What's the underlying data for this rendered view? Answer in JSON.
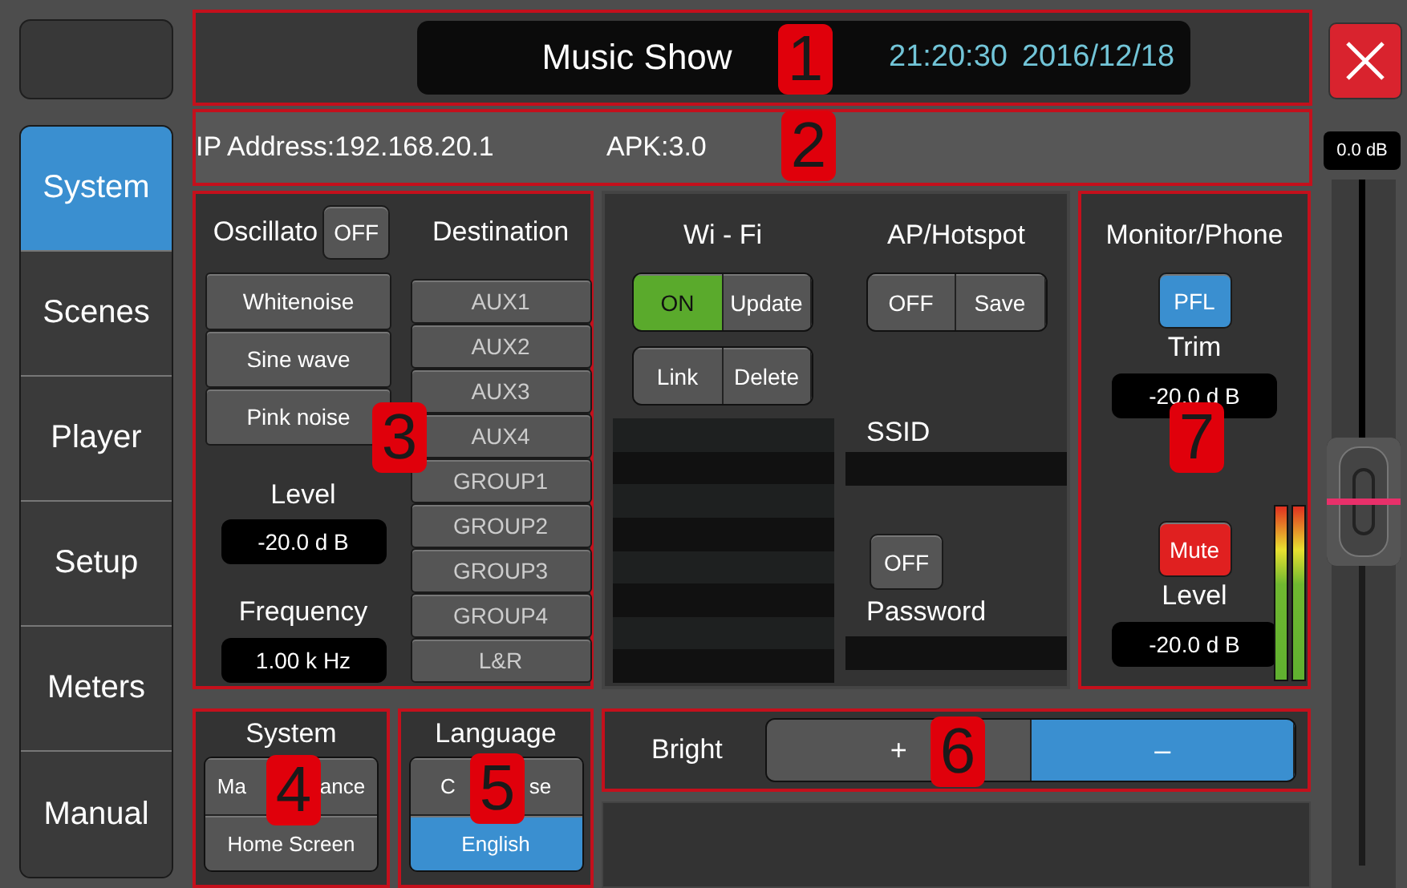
{
  "header": {
    "title": "Music Show",
    "time": "21:20:30",
    "date": "2016/12/18"
  },
  "nav": [
    {
      "label": "System",
      "selected": true
    },
    {
      "label": "Scenes",
      "selected": false
    },
    {
      "label": "Player",
      "selected": false
    },
    {
      "label": "Setup",
      "selected": false
    },
    {
      "label": "Meters",
      "selected": false
    },
    {
      "label": "Manual",
      "selected": false
    }
  ],
  "info": {
    "ip": "IP  Address:192.168.20.1",
    "apk": "APK:3.0"
  },
  "oscillator": {
    "label": "Oscillato",
    "power": {
      "label": "OFF",
      "on": false
    },
    "signals": [
      {
        "label": "Whitenoise",
        "selected": false
      },
      {
        "label": "Sine wave",
        "selected": false
      },
      {
        "label": "Pink noise",
        "selected": false
      }
    ],
    "level_label": "Level",
    "level_value": "-20.0 d B",
    "frequency_label": "Frequency",
    "frequency_value": "1.00 k Hz"
  },
  "destination": {
    "title": "Destination",
    "items": [
      {
        "label": "AUX1",
        "selected": false
      },
      {
        "label": "AUX2",
        "selected": false
      },
      {
        "label": "AUX3",
        "selected": false
      },
      {
        "label": "AUX4",
        "selected": false
      },
      {
        "label": "GROUP1",
        "selected": false
      },
      {
        "label": "GROUP2",
        "selected": false
      },
      {
        "label": "GROUP3",
        "selected": false
      },
      {
        "label": "GROUP4",
        "selected": false
      },
      {
        "label": "L&R",
        "selected": false
      }
    ]
  },
  "wifi": {
    "title": "Wi - Fi",
    "power": {
      "label": "ON",
      "on": true
    },
    "update": "Update",
    "link": "Link",
    "delete": "Delete"
  },
  "hotspot": {
    "title": "AP/Hotspot",
    "power": {
      "label": "OFF",
      "on": false
    },
    "save": "Save",
    "ssid_label": "SSID",
    "password_toggle": {
      "label": "OFF",
      "on": false
    },
    "password_label": "Password"
  },
  "monitor": {
    "title": "Monitor/Phone",
    "pfl": {
      "label": "PFL",
      "on": true
    },
    "trim_label": "Trim",
    "trim_value": "-20.0 d B",
    "mute": {
      "label": "Mute",
      "on": true
    },
    "level_label": "Level",
    "level_value": "-20.0 d B",
    "meters": [
      {
        "level": 1
      },
      {
        "level": 1
      }
    ]
  },
  "system_box": {
    "title": "System",
    "buttons": [
      {
        "parts": [
          "Ma",
          "ance"
        ],
        "selected": false
      },
      {
        "parts": [
          "Home Screen"
        ],
        "selected": false
      }
    ]
  },
  "language": {
    "title": "Language",
    "options": [
      {
        "parts": [
          "C",
          "se"
        ],
        "selected": false
      },
      {
        "parts": [
          "English"
        ],
        "selected": true
      }
    ]
  },
  "brightness": {
    "label": "Bright",
    "buttons": [
      {
        "label": "+",
        "selected": false
      },
      {
        "label": "–",
        "selected": true
      }
    ]
  },
  "fader": {
    "reading": "0.0 dB",
    "level": 0.53
  },
  "callouts": [
    "1",
    "2",
    "3",
    "4",
    "5",
    "6",
    "7"
  ]
}
